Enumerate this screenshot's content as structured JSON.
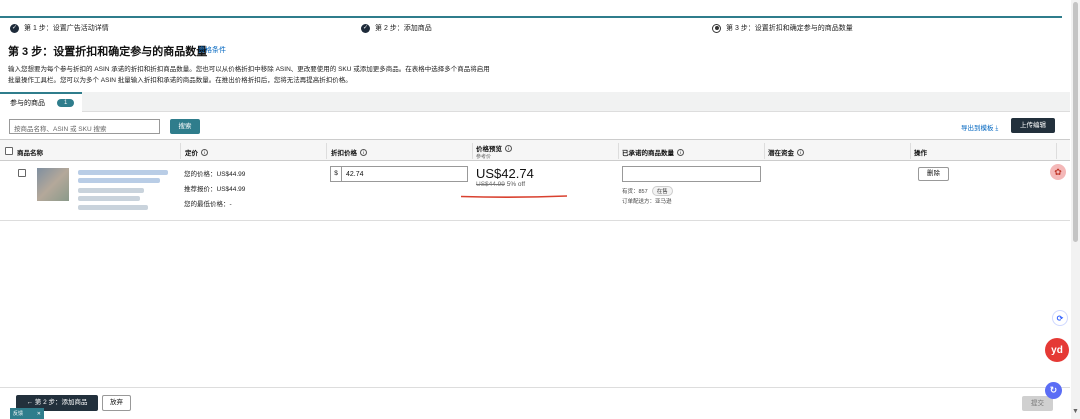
{
  "steps": [
    {
      "label": "第 1 步：设置广告活动详情",
      "state": "done"
    },
    {
      "label": "第 2 步：添加商品",
      "state": "done"
    },
    {
      "label": "第 3 步：设置折扣和确定参与的商品数量",
      "state": "current"
    }
  ],
  "page": {
    "title": "第 3 步：设置折扣和确定参与的商品数量",
    "eligibility_link": "资格条件",
    "description_line1": "输入您想要为每个参与折扣的 ASIN 承诺的折扣和折扣商品数量。您也可以从价格折扣中移除 ASIN、更改要使用的 SKU 或添加更多商品。在表格中选择多个商品将启用",
    "description_line2": "批量操作工具栏。您可以为多个 ASIN 批量输入折扣和承诺的商品数量。在推出价格折扣后，您将无法再提高折扣价格。"
  },
  "tab": {
    "label": "参与的商品",
    "count": "1"
  },
  "toolbar": {
    "search_placeholder": "按商品名称、ASIN 或 SKU 搜索",
    "search_button": "搜索",
    "export_link": "导出到模板",
    "upload_button": "上传编辑"
  },
  "table": {
    "headers": {
      "product": "商品名称",
      "price": "定价",
      "discount": "折扣价格",
      "preview": "价格预览",
      "preview_sub": "参考价",
      "committed": "已承诺的商品数量",
      "potential": "潜在资金",
      "actions": "操作"
    },
    "row": {
      "your_price_label": "您的价格：US$44.99",
      "list_price_label": "推荐报价：US$44.99",
      "lowest_price_label": "您的最低价格：-",
      "currency": "$",
      "discount_value": "42.74",
      "preview_price": "US$42.74",
      "original_price": "US$44.99",
      "percent_off": "5% off",
      "stock_label": "有货：857",
      "stock_tag": "在售",
      "fulfillment": "订单配送方：亚马逊",
      "delete_button": "删除"
    }
  },
  "footer": {
    "back_button": "← 第 2 步：添加商品",
    "abandon_button": "放弃",
    "submit_button": "提交",
    "feedback_label": "反馈"
  },
  "colors": {
    "accent": "#2f7d8c",
    "dark_button": "#22303c",
    "link": "#0066c0",
    "annotation_red": "#d9412f"
  }
}
